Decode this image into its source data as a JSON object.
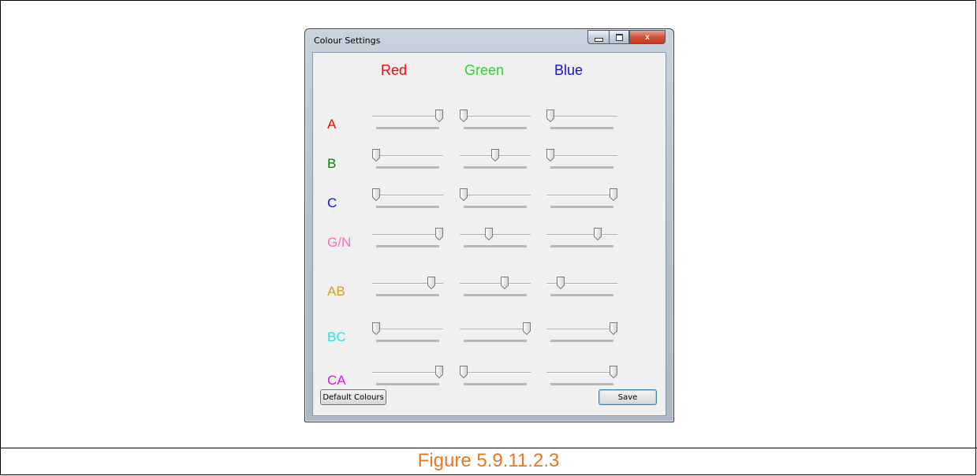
{
  "window": {
    "title": "Colour Settings",
    "controls": {
      "close_glyph": "x"
    }
  },
  "columns": [
    {
      "label": "Red",
      "color": "#ff0000"
    },
    {
      "label": "Green",
      "color": "#22dd22"
    },
    {
      "label": "Blue",
      "color": "#1010e0"
    }
  ],
  "rows": [
    {
      "label": "A",
      "color": "#ff0000",
      "values": [
        1.0,
        0.0,
        0.0
      ]
    },
    {
      "label": "B",
      "color": "#008000",
      "values": [
        0.0,
        0.5,
        0.0
      ]
    },
    {
      "label": "C",
      "color": "#1010e0",
      "values": [
        0.0,
        0.0,
        1.0
      ]
    },
    {
      "label": "G/N",
      "color": "#ff69b4",
      "values": [
        1.0,
        0.4,
        0.75
      ]
    },
    {
      "label": "AB",
      "color": "#d9a020",
      "values": [
        0.88,
        0.65,
        0.16
      ]
    },
    {
      "label": "BC",
      "color": "#22e6e6",
      "values": [
        0.0,
        1.0,
        1.0
      ]
    },
    {
      "label": "CA",
      "color": "#e010e0",
      "values": [
        1.0,
        0.0,
        1.0
      ]
    }
  ],
  "buttons": {
    "default_colours": "Default Colours",
    "save": "Save"
  },
  "caption": "Figure 5.9.11.2.3",
  "accent": "#e87722"
}
